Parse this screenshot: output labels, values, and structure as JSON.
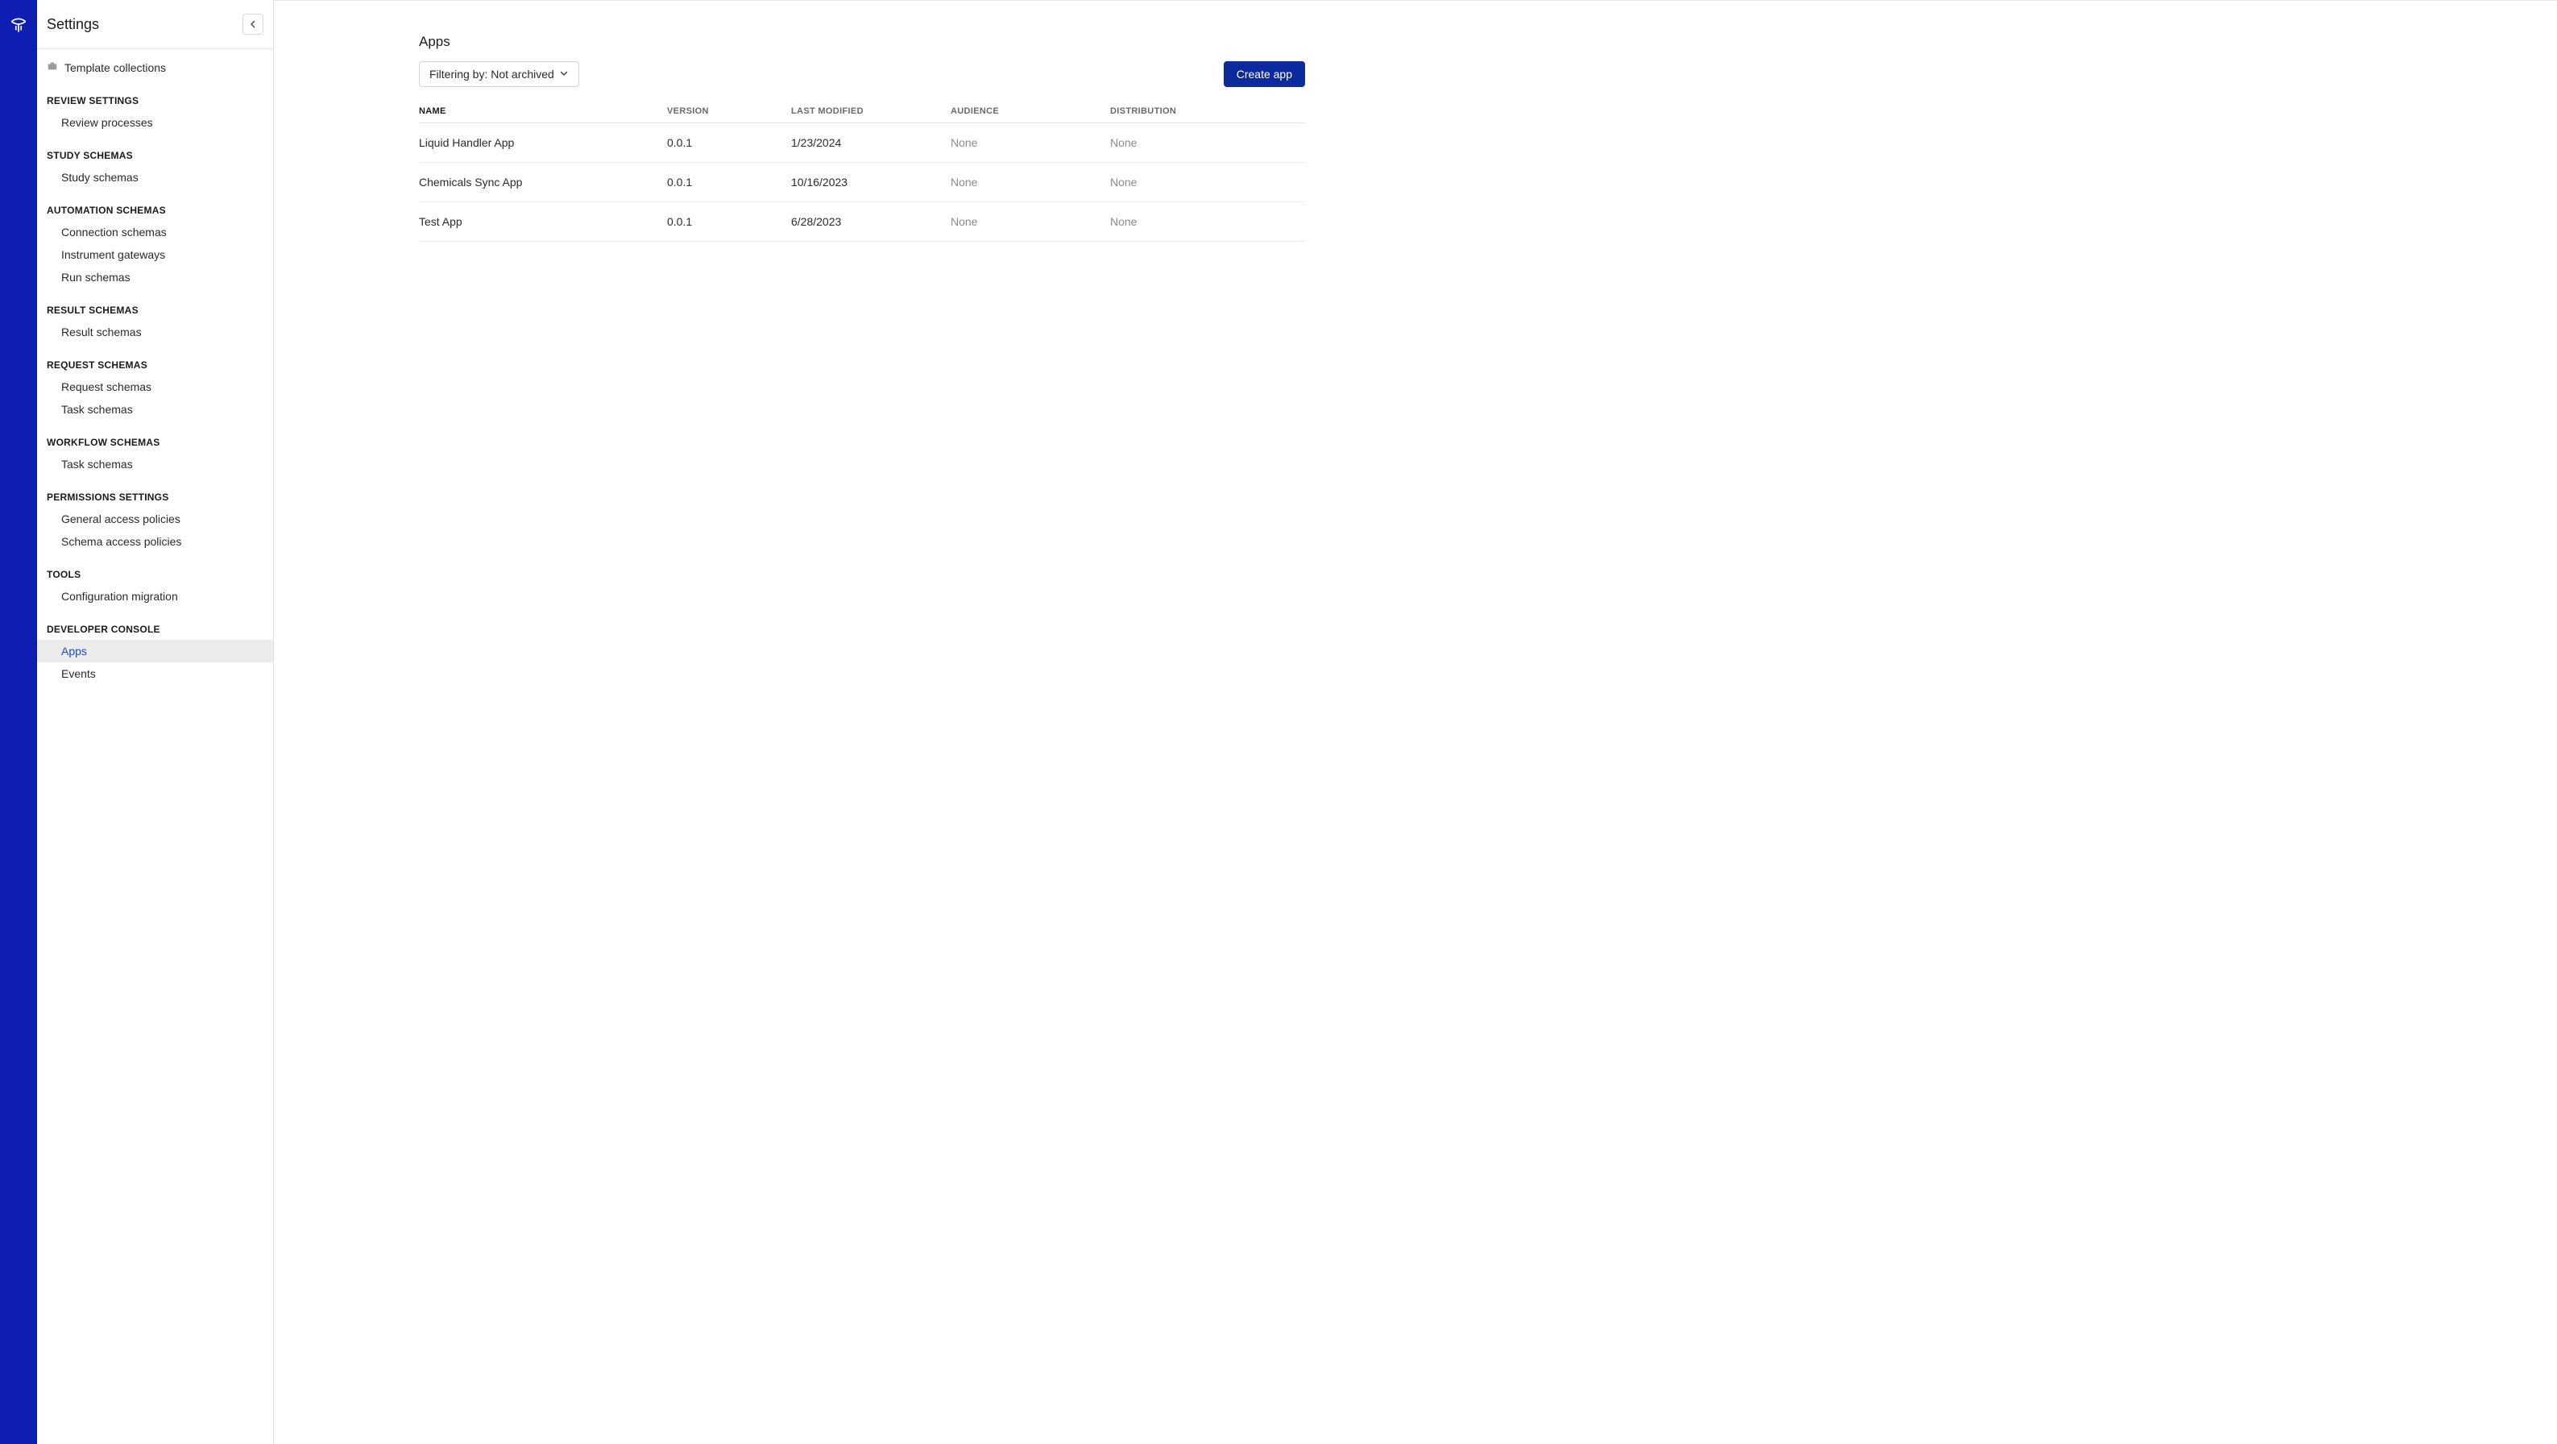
{
  "appRail": {
    "logoName": "benchling-logo"
  },
  "sidebar": {
    "title": "Settings",
    "collapseIconName": "chevron-left-icon",
    "topItem": {
      "label": "Template collections",
      "iconName": "briefcase-icon"
    },
    "sections": [
      {
        "heading": "REVIEW SETTINGS",
        "items": [
          {
            "label": "Review processes",
            "active": false
          }
        ]
      },
      {
        "heading": "STUDY SCHEMAS",
        "items": [
          {
            "label": "Study schemas",
            "active": false
          }
        ]
      },
      {
        "heading": "AUTOMATION SCHEMAS",
        "items": [
          {
            "label": "Connection schemas",
            "active": false
          },
          {
            "label": "Instrument gateways",
            "active": false
          },
          {
            "label": "Run schemas",
            "active": false
          }
        ]
      },
      {
        "heading": "RESULT SCHEMAS",
        "items": [
          {
            "label": "Result schemas",
            "active": false
          }
        ]
      },
      {
        "heading": "REQUEST SCHEMAS",
        "items": [
          {
            "label": "Request schemas",
            "active": false
          },
          {
            "label": "Task schemas",
            "active": false
          }
        ]
      },
      {
        "heading": "WORKFLOW SCHEMAS",
        "items": [
          {
            "label": "Task schemas",
            "active": false
          }
        ]
      },
      {
        "heading": "PERMISSIONS SETTINGS",
        "items": [
          {
            "label": "General access policies",
            "active": false
          },
          {
            "label": "Schema access policies",
            "active": false
          }
        ]
      },
      {
        "heading": "TOOLS",
        "items": [
          {
            "label": "Configuration migration",
            "active": false
          }
        ]
      },
      {
        "heading": "DEVELOPER CONSOLE",
        "items": [
          {
            "label": "Apps",
            "active": true
          },
          {
            "label": "Events",
            "active": false
          }
        ]
      }
    ]
  },
  "main": {
    "title": "Apps",
    "filterLabel": "Filtering by: Not archived",
    "createLabel": "Create app",
    "table": {
      "columns": [
        "NAME",
        "VERSION",
        "LAST MODIFIED",
        "AUDIENCE",
        "DISTRIBUTION"
      ],
      "rows": [
        {
          "name": "Liquid Handler App",
          "version": "0.0.1",
          "modified": "1/23/2024",
          "audience": "None",
          "distribution": "None"
        },
        {
          "name": "Chemicals Sync App",
          "version": "0.0.1",
          "modified": "10/16/2023",
          "audience": "None",
          "distribution": "None"
        },
        {
          "name": "Test App",
          "version": "0.0.1",
          "modified": "6/28/2023",
          "audience": "None",
          "distribution": "None"
        }
      ]
    }
  }
}
